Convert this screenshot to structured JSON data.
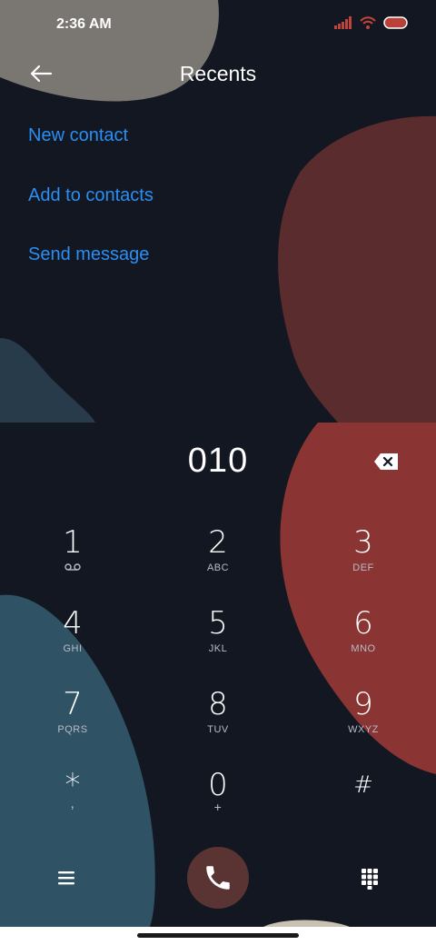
{
  "status_bar": {
    "time": "2:36 AM"
  },
  "header": {
    "title": "Recents"
  },
  "actions": [
    {
      "label": "New contact"
    },
    {
      "label": "Add to contacts"
    },
    {
      "label": "Send message"
    }
  ],
  "dialer": {
    "number": "010",
    "keys": [
      {
        "digit": "1",
        "letters": ""
      },
      {
        "digit": "2",
        "letters": "ABC"
      },
      {
        "digit": "3",
        "letters": "DEF"
      },
      {
        "digit": "4",
        "letters": "GHI"
      },
      {
        "digit": "5",
        "letters": "JKL"
      },
      {
        "digit": "6",
        "letters": "MNO"
      },
      {
        "digit": "7",
        "letters": "PQRS"
      },
      {
        "digit": "8",
        "letters": "TUV"
      },
      {
        "digit": "9",
        "letters": "WXYZ"
      },
      {
        "digit": "*",
        "letters": ","
      },
      {
        "digit": "0",
        "letters": "+"
      },
      {
        "digit": "#",
        "letters": ""
      }
    ]
  },
  "icons": {
    "back": "arrow-left-icon",
    "backspace": "backspace-icon",
    "voicemail": "voicemail-icon",
    "menu": "menu-icon",
    "call": "phone-icon",
    "dialpad": "dialpad-icon"
  },
  "colors": {
    "background": "#131722",
    "link": "#2a8ff4",
    "call_button": "#5a3333"
  }
}
